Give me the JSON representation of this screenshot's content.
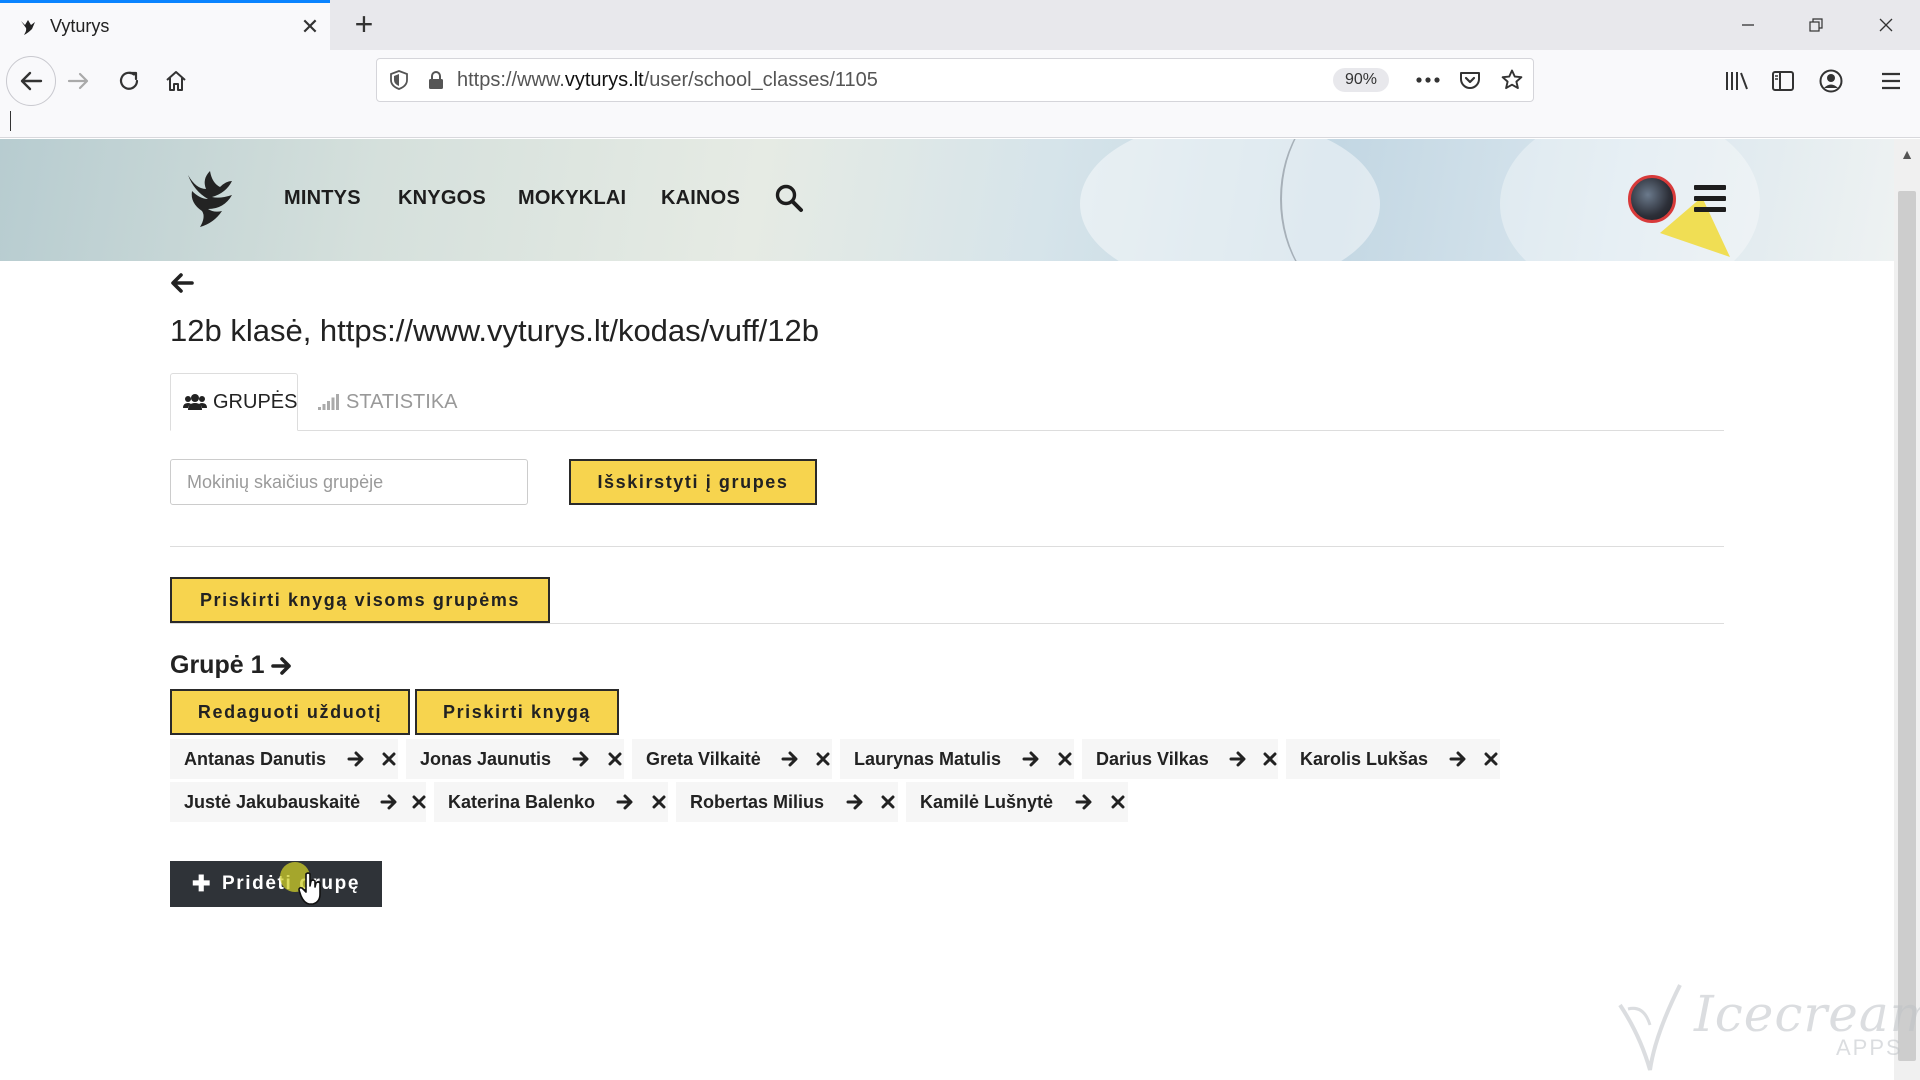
{
  "browser": {
    "tab_title": "Vyturys",
    "url_prefix": "https://www.",
    "url_domain": "vyturys.lt",
    "url_path": "/user/school_classes/1105",
    "zoom": "90%"
  },
  "site": {
    "menu": [
      "MINTYS",
      "KNYGOS",
      "MOKYKLAI",
      "KAINOS"
    ]
  },
  "page": {
    "title": "12b klasė, https://www.vyturys.lt/kodas/vuff/12b",
    "tabs": [
      "GRUPĖS",
      "STATISTIKA"
    ],
    "count_placeholder": "Mokinių skaičius grupėje",
    "split_button": "Išskirstyti į grupes",
    "assign_all_button": "Priskirti knygą visoms grupėms",
    "add_group_button": "Pridėti grupę"
  },
  "group": {
    "title": "Grupė 1",
    "edit_button": "Redaguoti užduotį",
    "assign_button": "Priskirti knygą",
    "students": [
      "Antanas Danutis",
      "Jonas Jaunutis",
      "Greta Vilkaitė",
      "Laurynas Matulis",
      "Darius Vilkas",
      "Karolis Lukšas",
      "Justė Jakubauskaitė",
      "Katerina Balenko",
      "Robertas Milius",
      "Kamilė Lušnytė"
    ]
  },
  "watermark": {
    "text": "Icecream",
    "sub": "APPS"
  }
}
